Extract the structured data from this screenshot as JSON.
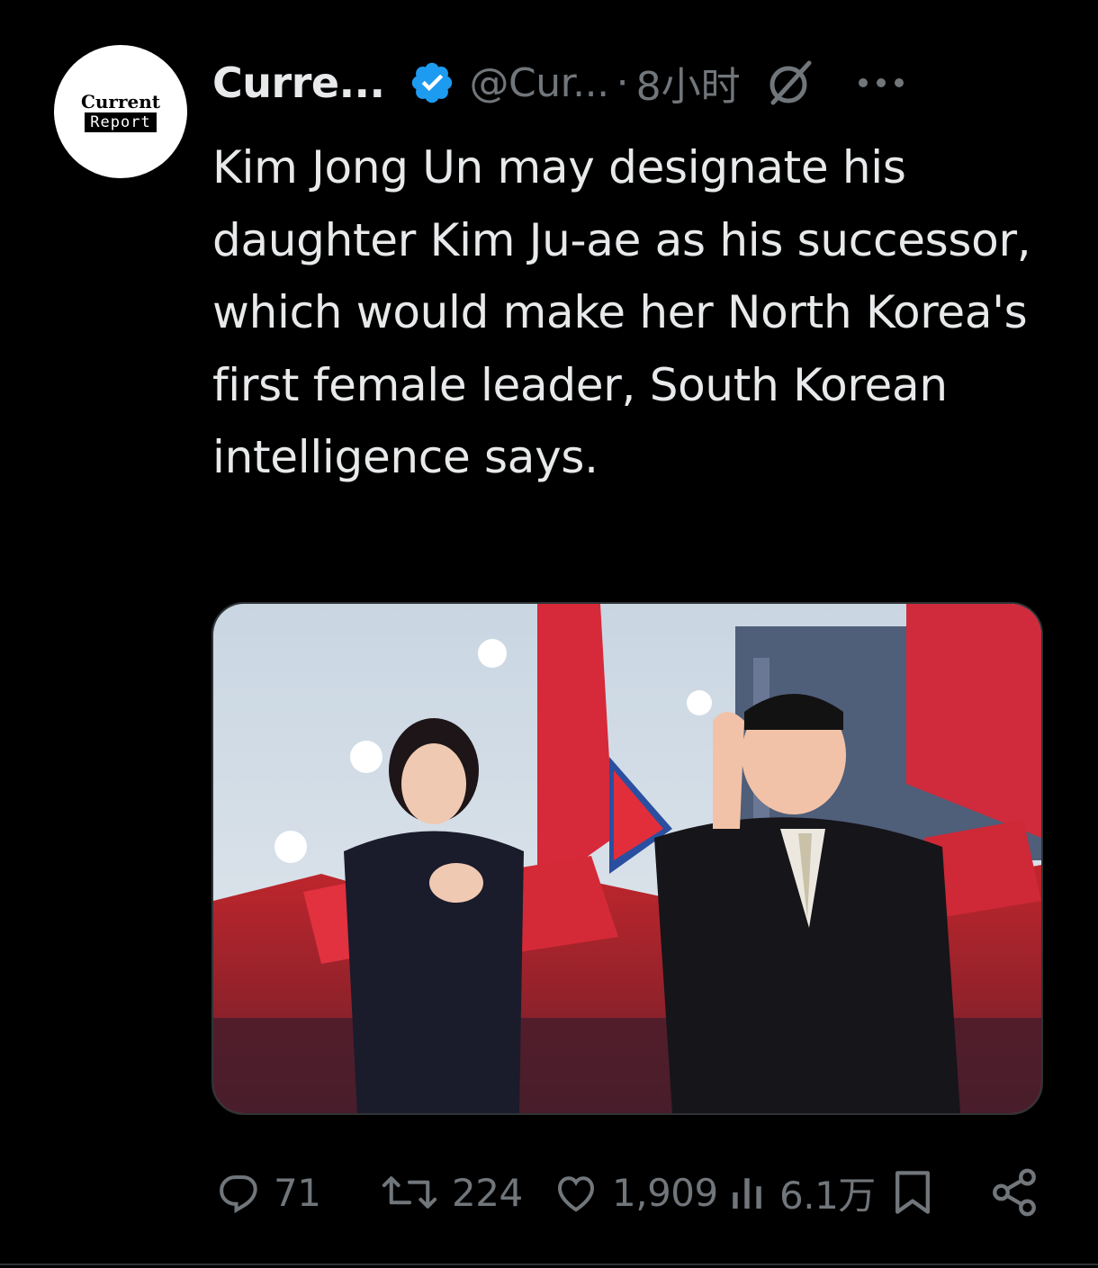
{
  "author": {
    "avatar_line1": "Current",
    "avatar_line2": "Report",
    "display_name": "Curre...",
    "handle": "@Cur...",
    "separator": "·",
    "timestamp": "8小时",
    "verified": true
  },
  "tweet": {
    "text": "Kim Jong Un may designate his daughter Kim Ju-ae as his successor, which would make her North Korea's first female leader, South Korean intelligence says."
  },
  "media": {
    "type": "photo"
  },
  "metrics": {
    "replies": "71",
    "reposts": "224",
    "likes": "1,909",
    "views": "6.1万"
  },
  "icons": {
    "verified": "verified-badge-icon",
    "grok": "grok-icon",
    "more": "more-icon",
    "reply": "reply-icon",
    "repost": "repost-icon",
    "like": "like-icon",
    "views": "views-icon",
    "bookmark": "bookmark-icon",
    "share": "share-icon"
  },
  "colors": {
    "background": "#000000",
    "text": "#e7e9ea",
    "muted": "#71767b",
    "verified": "#1d9bf0"
  }
}
